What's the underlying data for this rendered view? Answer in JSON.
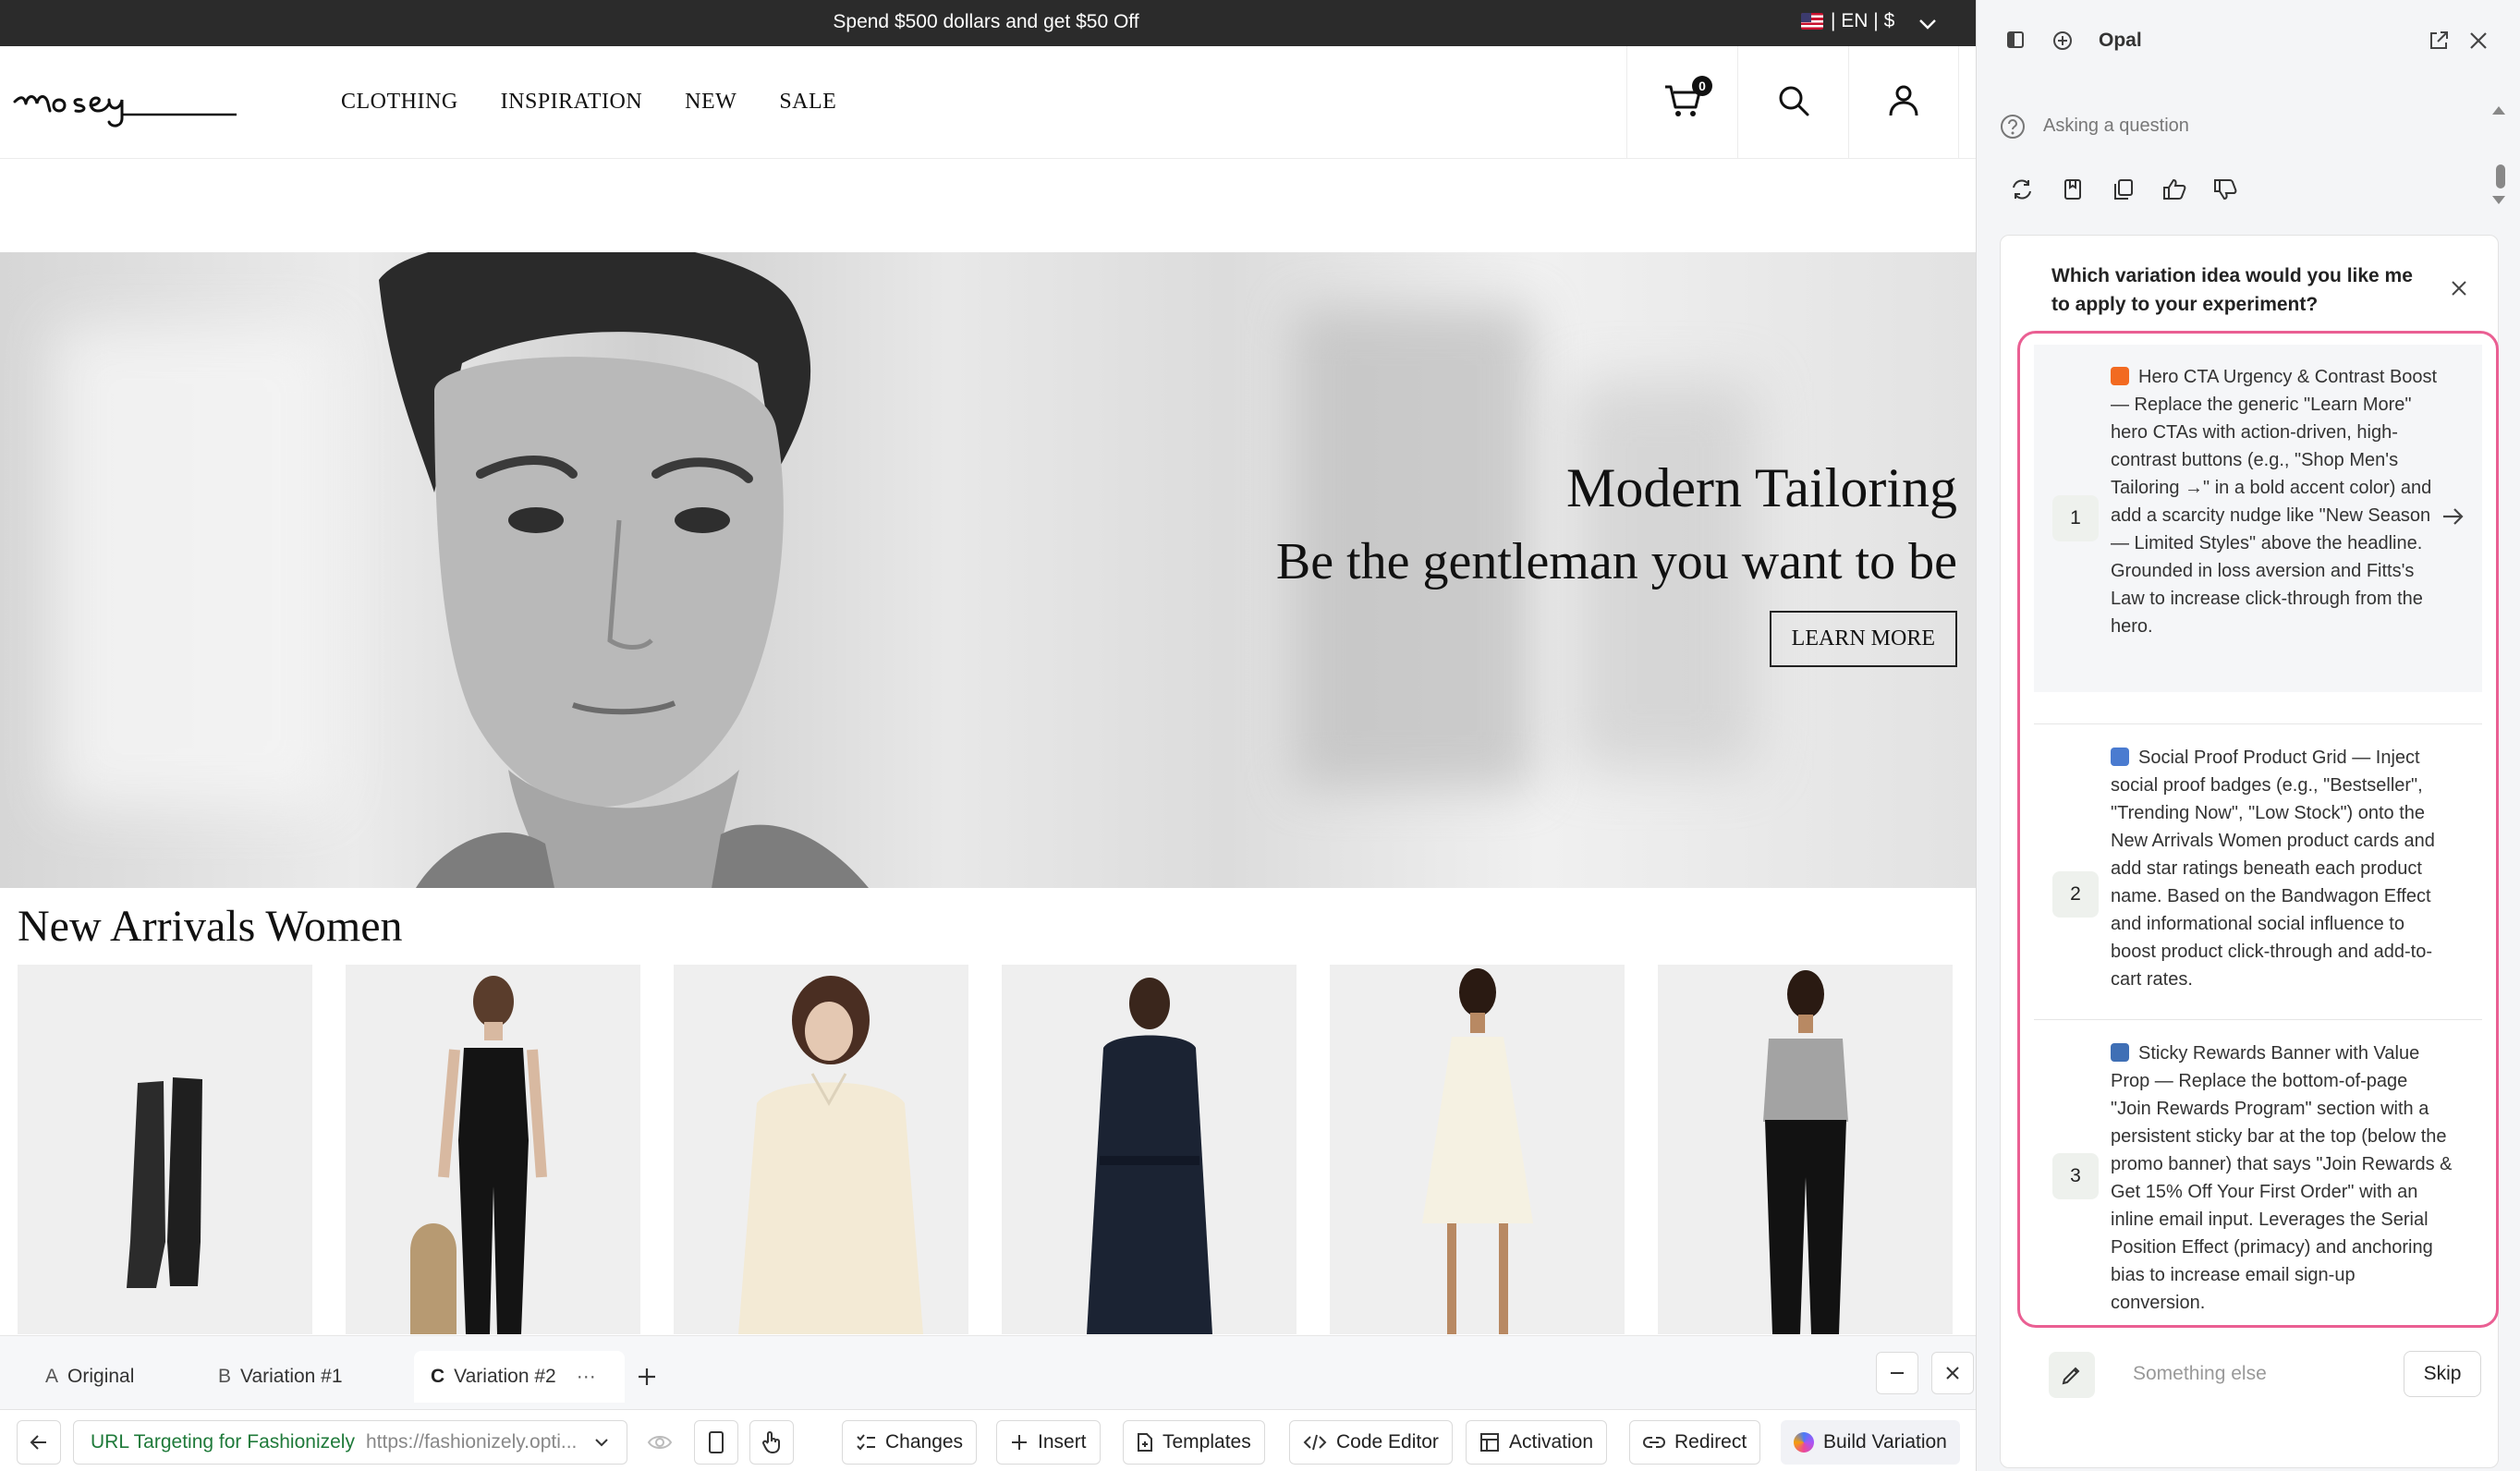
{
  "promo": {
    "message": "Spend $500 dollars and get $50 Off",
    "locale": "| EN | $"
  },
  "nav": {
    "links": [
      "CLOTHING",
      "INSPIRATION",
      "NEW",
      "SALE"
    ],
    "cart_count": "0"
  },
  "hero": {
    "title": "Modern Tailoring",
    "subtitle": "Be the gentleman you want to be",
    "cta": "LEARN MORE"
  },
  "arrivals": {
    "title": "New Arrivals Women"
  },
  "editor": {
    "tabs": [
      {
        "letter": "A",
        "label": "Original"
      },
      {
        "letter": "B",
        "label": "Variation #1"
      },
      {
        "letter": "C",
        "label": "Variation #2"
      }
    ],
    "more": "···",
    "url_name": "URL Targeting for Fashionizely",
    "url_value": "https://fashionizely.opti...",
    "buttons": {
      "changes": "Changes",
      "insert": "Insert",
      "templates": "Templates",
      "code_editor": "Code Editor",
      "activation": "Activation",
      "redirect": "Redirect",
      "build": "Build Variation"
    }
  },
  "panel": {
    "title": "Opal",
    "status": "Asking a question",
    "question": "Which variation idea would you like me to apply to your experiment?",
    "options": [
      {
        "num": "1",
        "text": "Hero CTA Urgency & Contrast Boost — Replace the generic \"Learn More\" hero CTAs with action-driven, high-contrast buttons (e.g., \"Shop Men's Tailoring →\" in a bold accent color) and add a scarcity nudge like \"New Season — Limited Styles\" above the headline. Grounded in loss aversion and Fitts's Law to increase click-through from the hero.",
        "emoji_color": "#f26a21"
      },
      {
        "num": "2",
        "text": "Social Proof Product Grid — Inject social proof badges (e.g., \"Bestseller\", \"Trending Now\", \"Low Stock\") onto the New Arrivals Women product cards and add star ratings beneath each product name. Based on the Bandwagon Effect and informational social influence to boost product click-through and add-to-cart rates.",
        "emoji_color": "#4a7bd0"
      },
      {
        "num": "3",
        "text": "Sticky Rewards Banner with Value Prop — Replace the bottom-of-page \"Join Rewards Program\" section with a persistent sticky bar at the top (below the promo banner) that says \"Join Rewards & Get 15% Off Your First Order\" with an inline email input. Leverages the Serial Position Effect (primacy) and anchoring bias to increase email sign-up conversion.",
        "emoji_color": "#3f6fb5"
      }
    ],
    "other_placeholder": "Something else",
    "skip": "Skip"
  },
  "colors": {
    "accent_pink": "#ea5f93",
    "url_green": "#1f7a3a",
    "promo_bg": "#2b2b2b"
  }
}
